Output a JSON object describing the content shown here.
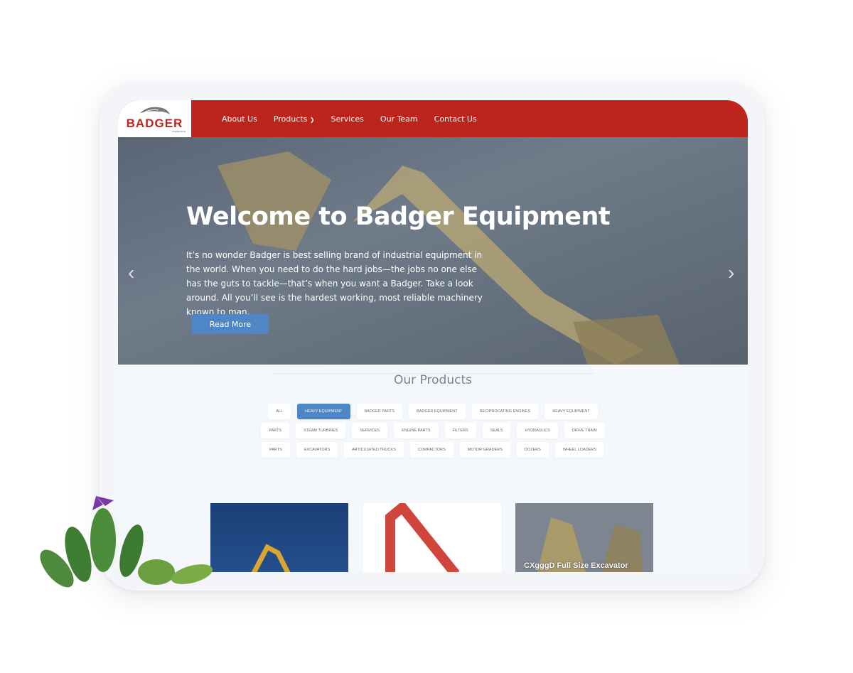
{
  "logo": {
    "text": "BADGER",
    "subtext": "equipment"
  },
  "nav": {
    "items": [
      "About Us",
      "Products",
      "Services",
      "Our Team",
      "Contact Us"
    ],
    "dropdown_icon": "chevron-down-icon"
  },
  "hero": {
    "title": "Welcome to Badger Equipment",
    "body": "It’s no wonder Badger is best selling brand of industrial equipment in the world. When you need to do the hard jobs—the jobs no one else has the guts to tackle—that’s when you want a Badger. Take a look around. All you’ll see is the hardest working, most reliable machinery known to man.",
    "button": "Read More",
    "prev": "‹",
    "next": "›"
  },
  "products": {
    "title": "Our Products",
    "filters": [
      "ALL",
      "HEAVY EQUIPMENT",
      "BADGER PARTS",
      "BADGER EQUIPMENT",
      "RECIPROCATING ENGINES",
      "HEAVY EQUIPMENT",
      "PARTS",
      "STEAM TURBINES",
      "SERVICES",
      "ENGINE PARTS",
      "FILTERS",
      "SEALS",
      "HYDRAULICS",
      "DRIVE TRAIN",
      "PARTS",
      "EXCAVATORS",
      "ARTICULATED TRUCKS",
      "COMPACTORS",
      "MOTOR GRADERS",
      "DOZERS",
      "WHEEL LOADERS"
    ],
    "active_filter": "HEAVY EQUIPMENT",
    "cards": [
      {
        "caption": ""
      },
      {
        "caption": ""
      },
      {
        "caption": "CXgggD Full Size Excavator"
      }
    ]
  },
  "colors": {
    "brand": "#bd241b",
    "accent": "#4f86c6"
  }
}
